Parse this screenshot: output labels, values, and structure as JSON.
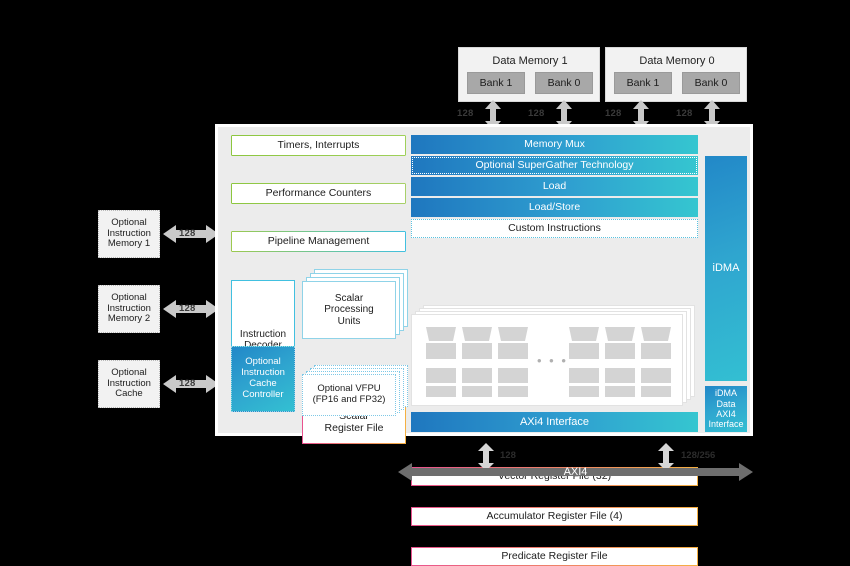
{
  "memories": [
    {
      "title": "Data Memory 1",
      "banks": [
        "Bank 1",
        "Bank 0"
      ],
      "widths": [
        "128",
        "128"
      ]
    },
    {
      "title": "Data Memory 0",
      "banks": [
        "Bank 1",
        "Bank 0"
      ],
      "widths": [
        "128",
        "128"
      ]
    }
  ],
  "left_inputs": [
    {
      "label": "Optional\nInstruction\nMemory 1",
      "width": "128"
    },
    {
      "label": "Optional\nInstruction\nMemory 2",
      "width": "128"
    },
    {
      "label": "Optional\nInstruction\nCache",
      "width": "128"
    }
  ],
  "control_blocks": [
    {
      "label": "Timers, Interrupts"
    },
    {
      "label": "Performance Counters"
    },
    {
      "label": "Pipeline Management"
    }
  ],
  "core": {
    "instruction_decoder": "Instruction\nDecoder",
    "scalar_register_file": "Scalar\nRegister File",
    "scalar_processing_units": "Scalar\nProcessing\nUnits",
    "instruction_cache_controller": "Optional\nInstruction\nCache\nController",
    "optional_vfpu": "Optional VFPU\n(FP16 and FP32)"
  },
  "memory_path": [
    {
      "label": "Memory Mux",
      "style": "blue"
    },
    {
      "label": "Optional SuperGather Technology",
      "style": "blue-dotted"
    },
    {
      "label": "Load",
      "style": "blue"
    },
    {
      "label": "Load/Store",
      "style": "blue"
    },
    {
      "label": "Custom Instructions",
      "style": "white-dotted"
    },
    {
      "label": "Vector Register File (32)",
      "style": "pink-orange"
    },
    {
      "label": "Accumulator Register File (4)",
      "style": "pink-orange"
    },
    {
      "label": "Predicate Register File",
      "style": "pink-orange"
    }
  ],
  "vector_grid": {
    "dots": "• • •"
  },
  "axi4_interface": "AXi4 Interface",
  "idma": {
    "label": "iDMA",
    "axi_label": "iDMA Data\nAXI4\nInterface"
  },
  "bottom_bus": {
    "label": "AXI4",
    "left_width": "128",
    "right_width": "128/256"
  },
  "colors": {
    "blue_start": "#1f77bf",
    "blue_end": "#35c6d0",
    "green": "#8cc63f",
    "cyan": "#41c0e0",
    "pink": "#e9528e",
    "orange": "#f5a623",
    "gray_bank": "#a8a8a8",
    "bus_gray": "#6e6e6e"
  }
}
